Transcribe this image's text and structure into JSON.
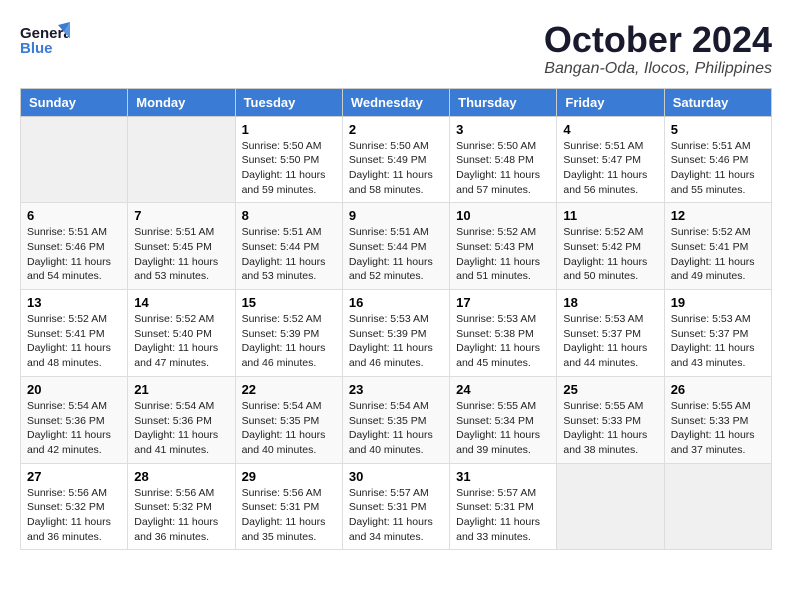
{
  "header": {
    "logo_general": "General",
    "logo_blue": "Blue",
    "month_title": "October 2024",
    "location": "Bangan-Oda, Ilocos, Philippines"
  },
  "columns": [
    "Sunday",
    "Monday",
    "Tuesday",
    "Wednesday",
    "Thursday",
    "Friday",
    "Saturday"
  ],
  "weeks": [
    [
      {
        "num": "",
        "info": ""
      },
      {
        "num": "",
        "info": ""
      },
      {
        "num": "1",
        "info": "Sunrise: 5:50 AM\nSunset: 5:50 PM\nDaylight: 11 hours and 59 minutes."
      },
      {
        "num": "2",
        "info": "Sunrise: 5:50 AM\nSunset: 5:49 PM\nDaylight: 11 hours and 58 minutes."
      },
      {
        "num": "3",
        "info": "Sunrise: 5:50 AM\nSunset: 5:48 PM\nDaylight: 11 hours and 57 minutes."
      },
      {
        "num": "4",
        "info": "Sunrise: 5:51 AM\nSunset: 5:47 PM\nDaylight: 11 hours and 56 minutes."
      },
      {
        "num": "5",
        "info": "Sunrise: 5:51 AM\nSunset: 5:46 PM\nDaylight: 11 hours and 55 minutes."
      }
    ],
    [
      {
        "num": "6",
        "info": "Sunrise: 5:51 AM\nSunset: 5:46 PM\nDaylight: 11 hours and 54 minutes."
      },
      {
        "num": "7",
        "info": "Sunrise: 5:51 AM\nSunset: 5:45 PM\nDaylight: 11 hours and 53 minutes."
      },
      {
        "num": "8",
        "info": "Sunrise: 5:51 AM\nSunset: 5:44 PM\nDaylight: 11 hours and 53 minutes."
      },
      {
        "num": "9",
        "info": "Sunrise: 5:51 AM\nSunset: 5:44 PM\nDaylight: 11 hours and 52 minutes."
      },
      {
        "num": "10",
        "info": "Sunrise: 5:52 AM\nSunset: 5:43 PM\nDaylight: 11 hours and 51 minutes."
      },
      {
        "num": "11",
        "info": "Sunrise: 5:52 AM\nSunset: 5:42 PM\nDaylight: 11 hours and 50 minutes."
      },
      {
        "num": "12",
        "info": "Sunrise: 5:52 AM\nSunset: 5:41 PM\nDaylight: 11 hours and 49 minutes."
      }
    ],
    [
      {
        "num": "13",
        "info": "Sunrise: 5:52 AM\nSunset: 5:41 PM\nDaylight: 11 hours and 48 minutes."
      },
      {
        "num": "14",
        "info": "Sunrise: 5:52 AM\nSunset: 5:40 PM\nDaylight: 11 hours and 47 minutes."
      },
      {
        "num": "15",
        "info": "Sunrise: 5:52 AM\nSunset: 5:39 PM\nDaylight: 11 hours and 46 minutes."
      },
      {
        "num": "16",
        "info": "Sunrise: 5:53 AM\nSunset: 5:39 PM\nDaylight: 11 hours and 46 minutes."
      },
      {
        "num": "17",
        "info": "Sunrise: 5:53 AM\nSunset: 5:38 PM\nDaylight: 11 hours and 45 minutes."
      },
      {
        "num": "18",
        "info": "Sunrise: 5:53 AM\nSunset: 5:37 PM\nDaylight: 11 hours and 44 minutes."
      },
      {
        "num": "19",
        "info": "Sunrise: 5:53 AM\nSunset: 5:37 PM\nDaylight: 11 hours and 43 minutes."
      }
    ],
    [
      {
        "num": "20",
        "info": "Sunrise: 5:54 AM\nSunset: 5:36 PM\nDaylight: 11 hours and 42 minutes."
      },
      {
        "num": "21",
        "info": "Sunrise: 5:54 AM\nSunset: 5:36 PM\nDaylight: 11 hours and 41 minutes."
      },
      {
        "num": "22",
        "info": "Sunrise: 5:54 AM\nSunset: 5:35 PM\nDaylight: 11 hours and 40 minutes."
      },
      {
        "num": "23",
        "info": "Sunrise: 5:54 AM\nSunset: 5:35 PM\nDaylight: 11 hours and 40 minutes."
      },
      {
        "num": "24",
        "info": "Sunrise: 5:55 AM\nSunset: 5:34 PM\nDaylight: 11 hours and 39 minutes."
      },
      {
        "num": "25",
        "info": "Sunrise: 5:55 AM\nSunset: 5:33 PM\nDaylight: 11 hours and 38 minutes."
      },
      {
        "num": "26",
        "info": "Sunrise: 5:55 AM\nSunset: 5:33 PM\nDaylight: 11 hours and 37 minutes."
      }
    ],
    [
      {
        "num": "27",
        "info": "Sunrise: 5:56 AM\nSunset: 5:32 PM\nDaylight: 11 hours and 36 minutes."
      },
      {
        "num": "28",
        "info": "Sunrise: 5:56 AM\nSunset: 5:32 PM\nDaylight: 11 hours and 36 minutes."
      },
      {
        "num": "29",
        "info": "Sunrise: 5:56 AM\nSunset: 5:31 PM\nDaylight: 11 hours and 35 minutes."
      },
      {
        "num": "30",
        "info": "Sunrise: 5:57 AM\nSunset: 5:31 PM\nDaylight: 11 hours and 34 minutes."
      },
      {
        "num": "31",
        "info": "Sunrise: 5:57 AM\nSunset: 5:31 PM\nDaylight: 11 hours and 33 minutes."
      },
      {
        "num": "",
        "info": ""
      },
      {
        "num": "",
        "info": ""
      }
    ]
  ]
}
